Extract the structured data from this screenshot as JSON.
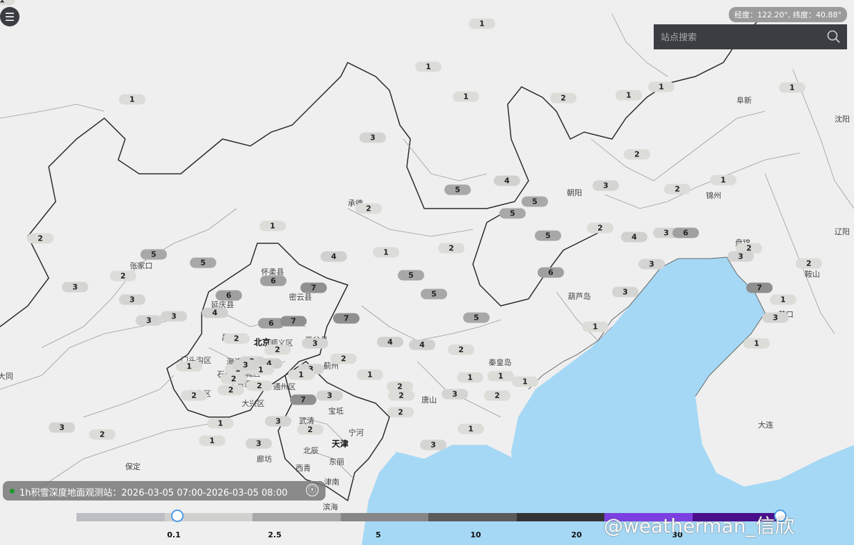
{
  "coordinates": "经度：122.20°, 纬度：40.88°",
  "search": {
    "placeholder": "站点搜索"
  },
  "info_bar": {
    "text": "1h积雪深度地面观测站：2026-03-05 07:00-2026-03-05 08:00",
    "close_symbol": "ⓧ"
  },
  "legend": {
    "ticks": [
      "0.1",
      "2.5",
      "5",
      "10",
      "20",
      "30"
    ],
    "colors": [
      "#bcbec4",
      "#d0d0ce",
      "#a8a8a8",
      "#868686",
      "#5a5a5a",
      "#333333",
      "#7c3fe0",
      "#4a0f8a"
    ]
  },
  "watermark": "@weatherman_信欣",
  "cities": [
    {
      "name": "阜新"
    },
    {
      "name": "沈阳"
    },
    {
      "name": "朝阳"
    },
    {
      "name": "锦州"
    },
    {
      "name": "承德"
    },
    {
      "name": "张家口"
    },
    {
      "name": "怀柔县"
    },
    {
      "name": "密云县"
    },
    {
      "name": "延庆县"
    },
    {
      "name": "昌平区"
    },
    {
      "name": "北京"
    },
    {
      "name": "顺义区"
    },
    {
      "name": "平谷县"
    },
    {
      "name": "门头沟区"
    },
    {
      "name": "海淀区"
    },
    {
      "name": "朝阳区"
    },
    {
      "name": "石景山区"
    },
    {
      "name": "东城区"
    },
    {
      "name": "丰台区"
    },
    {
      "name": "通州区"
    },
    {
      "name": "房山区"
    },
    {
      "name": "大兴区"
    },
    {
      "name": "蓟州"
    },
    {
      "name": "宝坻"
    },
    {
      "name": "唐山"
    },
    {
      "name": "秦皇岛"
    },
    {
      "name": "葫芦岛"
    },
    {
      "name": "盘锦"
    },
    {
      "name": "鞍山"
    },
    {
      "name": "辽阳"
    },
    {
      "name": "营口"
    },
    {
      "name": "大连"
    },
    {
      "name": "大同"
    },
    {
      "name": "保定"
    },
    {
      "name": "廊坊"
    },
    {
      "name": "武清"
    },
    {
      "name": "宁河"
    },
    {
      "name": "天津"
    },
    {
      "name": "北辰"
    },
    {
      "name": "东丽"
    },
    {
      "name": "西青"
    },
    {
      "name": "津南"
    },
    {
      "name": "滨海"
    }
  ],
  "stations": [
    {
      "value": "1",
      "color": "#dcdcd8"
    },
    {
      "value": "1",
      "color": "#dcdcd8"
    },
    {
      "value": "1",
      "color": "#dcdcd8"
    },
    {
      "value": "2",
      "color": "#dcdcd8"
    },
    {
      "value": "1",
      "color": "#dcdcd8"
    },
    {
      "value": "1",
      "color": "#dcdcd8"
    },
    {
      "value": "1",
      "color": "#dcdcd8"
    },
    {
      "value": "1",
      "color": "#dcdcd8"
    },
    {
      "value": "3",
      "color": "#d4d4d2"
    },
    {
      "value": "2",
      "color": "#dcdcd8"
    },
    {
      "value": "5",
      "color": "#a8a8a8"
    },
    {
      "value": "4",
      "color": "#d0d0ce"
    },
    {
      "value": "3",
      "color": "#d4d4d2"
    },
    {
      "value": "2",
      "color": "#dcdcd8"
    },
    {
      "value": "1",
      "color": "#dcdcd8"
    },
    {
      "value": "5",
      "color": "#a8a8a8"
    },
    {
      "value": "5",
      "color": "#a8a8a8"
    },
    {
      "value": "2",
      "color": "#dcdcd8"
    },
    {
      "value": "2",
      "color": "#dcdcd8"
    },
    {
      "value": "1",
      "color": "#dcdcd8"
    },
    {
      "value": "5",
      "color": "#a8a8a8"
    },
    {
      "value": "2",
      "color": "#dcdcd8"
    },
    {
      "value": "4",
      "color": "#d0d0ce"
    },
    {
      "value": "3",
      "color": "#d4d4d2"
    },
    {
      "value": "2",
      "color": "#dcdcd8"
    },
    {
      "value": "1",
      "color": "#dcdcd8"
    },
    {
      "value": "6",
      "color": "#a0a0a0"
    },
    {
      "value": "5",
      "color": "#a8a8a8"
    },
    {
      "value": "4",
      "color": "#d0d0ce"
    },
    {
      "value": "5",
      "color": "#a8a8a8"
    },
    {
      "value": "2",
      "color": "#dcdcd8"
    },
    {
      "value": "3",
      "color": "#d4d4d2"
    },
    {
      "value": "3",
      "color": "#d4d4d2"
    },
    {
      "value": "2",
      "color": "#dcdcd8"
    },
    {
      "value": "6",
      "color": "#a0a0a0"
    },
    {
      "value": "5",
      "color": "#a8a8a8"
    },
    {
      "value": "3",
      "color": "#d4d4d2"
    },
    {
      "value": "6",
      "color": "#a0a0a0"
    },
    {
      "value": "7",
      "color": "#8f8f8f"
    },
    {
      "value": "5",
      "color": "#a8a8a8"
    },
    {
      "value": "6",
      "color": "#a0a0a0"
    },
    {
      "value": "4",
      "color": "#d0d0ce"
    },
    {
      "value": "2",
      "color": "#dcdcd8"
    },
    {
      "value": "3",
      "color": "#d4d4d2"
    },
    {
      "value": "6",
      "color": "#a0a0a0"
    },
    {
      "value": "7",
      "color": "#8f8f8f"
    },
    {
      "value": "7",
      "color": "#8f8f8f"
    },
    {
      "value": "5",
      "color": "#a8a8a8"
    },
    {
      "value": "7",
      "color": "#8f8f8f"
    },
    {
      "value": "3",
      "color": "#d4d4d2"
    },
    {
      "value": "1",
      "color": "#dcdcd8"
    },
    {
      "value": "3",
      "color": "#d4d4d2"
    },
    {
      "value": "3",
      "color": "#d4d4d2"
    },
    {
      "value": "4",
      "color": "#d0d0ce"
    },
    {
      "value": "4",
      "color": "#d0d0ce"
    },
    {
      "value": "2",
      "color": "#dcdcd8"
    },
    {
      "value": "2",
      "color": "#dcdcd8"
    },
    {
      "value": "3",
      "color": "#d4d4d2"
    },
    {
      "value": "2",
      "color": "#dcdcd8"
    },
    {
      "value": "2",
      "color": "#dcdcd8"
    },
    {
      "value": "1",
      "color": "#dcdcd8"
    },
    {
      "value": "3",
      "color": "#d4d4d2"
    },
    {
      "value": "4",
      "color": "#d0d0ce"
    },
    {
      "value": "1",
      "color": "#dcdcd8"
    },
    {
      "value": "1",
      "color": "#dcdcd8"
    },
    {
      "value": "3",
      "color": "#d4d4d2"
    },
    {
      "value": "2",
      "color": "#dcdcd8"
    },
    {
      "value": "3",
      "color": "#d4d4d2"
    },
    {
      "value": "2",
      "color": "#dcdcd8"
    },
    {
      "value": "2",
      "color": "#dcdcd8"
    },
    {
      "value": "2",
      "color": "#dcdcd8"
    },
    {
      "value": "1",
      "color": "#dcdcd8"
    },
    {
      "value": "1",
      "color": "#dcdcd8"
    },
    {
      "value": "2",
      "color": "#dcdcd8"
    },
    {
      "value": "2",
      "color": "#dcdcd8"
    },
    {
      "value": "1",
      "color": "#dcdcd8"
    },
    {
      "value": "1",
      "color": "#dcdcd8"
    },
    {
      "value": "1",
      "color": "#dcdcd8"
    },
    {
      "value": "1",
      "color": "#dcdcd8"
    },
    {
      "value": "2",
      "color": "#dcdcd8"
    },
    {
      "value": "3",
      "color": "#d4d4d2"
    },
    {
      "value": "2",
      "color": "#dcdcd8"
    },
    {
      "value": "3",
      "color": "#d4d4d2"
    },
    {
      "value": "7",
      "color": "#8f8f8f"
    },
    {
      "value": "1",
      "color": "#dcdcd8"
    },
    {
      "value": "3",
      "color": "#d4d4d2"
    },
    {
      "value": "2",
      "color": "#dcdcd8"
    },
    {
      "value": "3",
      "color": "#d4d4d2"
    },
    {
      "value": "3",
      "color": "#d4d4d2"
    },
    {
      "value": "2",
      "color": "#dcdcd8"
    },
    {
      "value": "1",
      "color": "#dcdcd8"
    },
    {
      "value": "3",
      "color": "#d4d4d2"
    },
    {
      "value": "3",
      "color": "#d4d4d2"
    },
    {
      "value": "1",
      "color": "#dcdcd8"
    },
    {
      "value": "1",
      "color": "#dcdcd8"
    },
    {
      "value": "1",
      "color": "#dcdcd8"
    },
    {
      "value": "1",
      "color": "#dcdcd8"
    },
    {
      "value": "3",
      "color": "#d4d4d2"
    },
    {
      "value": "2",
      "color": "#dcdcd8"
    },
    {
      "value": "1",
      "color": "#dcdcd8"
    },
    {
      "value": "1",
      "color": "#dcdcd8"
    },
    {
      "value": "2",
      "color": "#dcdcd8"
    },
    {
      "value": "2",
      "color": "#dcdcd8"
    },
    {
      "value": "1",
      "color": "#dcdcd8"
    },
    {
      "value": "1",
      "color": "#dcdcd8"
    },
    {
      "value": "1",
      "color": "#dcdcd8"
    },
    {
      "value": "1",
      "color": "#dcdcd8"
    },
    {
      "value": "2",
      "color": "#dcdcd8"
    }
  ]
}
